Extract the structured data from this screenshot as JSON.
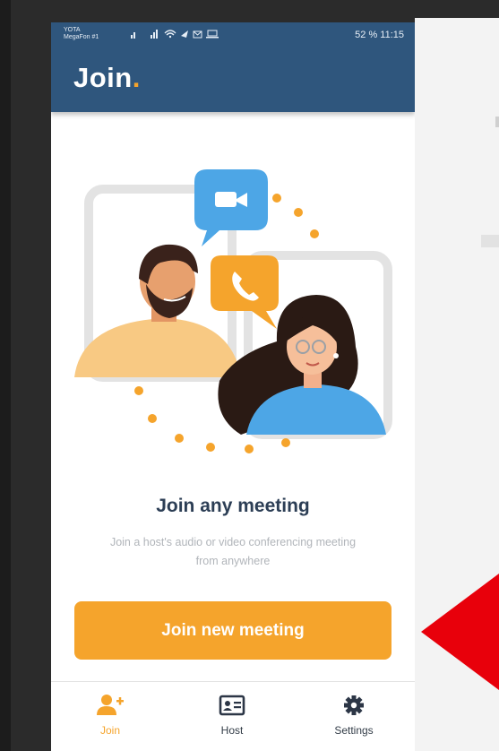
{
  "status_bar": {
    "carrier_line1": "YOTA",
    "carrier_line2": "MegaFon #1",
    "right": "52 %  11:15"
  },
  "app_bar": {
    "title": "Join",
    "title_dot": "."
  },
  "content": {
    "heading": "Join any meeting",
    "subtext": "Join a host's audio or video conferencing meeting from anywhere",
    "join_button_label": "Join new meeting"
  },
  "bottom_nav": {
    "items": [
      {
        "label": "Join",
        "icon": "add-user-icon",
        "active": true
      },
      {
        "label": "Host",
        "icon": "id-card-icon",
        "active": false
      },
      {
        "label": "Settings",
        "icon": "gear-icon",
        "active": false
      }
    ]
  },
  "colors": {
    "app_bar": "#2f567d",
    "accent": "#f5a42c",
    "heading": "#2c3e55",
    "subtext": "#b1b5ba",
    "annotation_arrow": "#e8000b"
  }
}
